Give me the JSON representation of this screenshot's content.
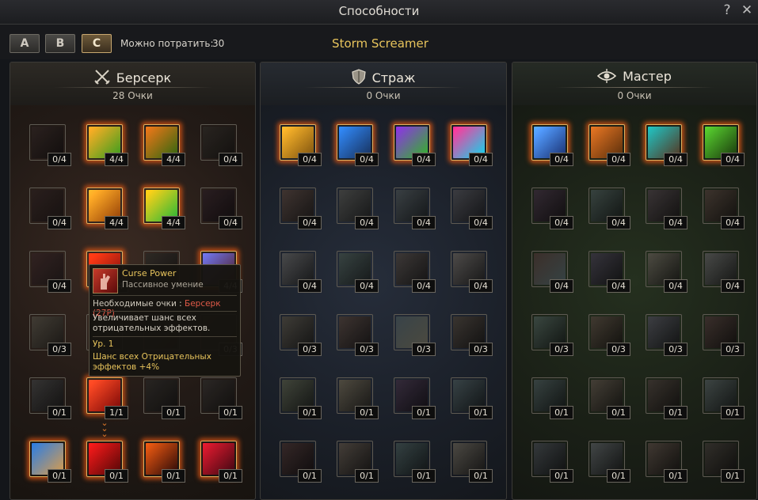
{
  "window": {
    "title": "Способности",
    "help_icon": "?",
    "close_icon": "✕"
  },
  "toolbar": {
    "tabs": [
      {
        "label": "A"
      },
      {
        "label": "B"
      },
      {
        "label": "C"
      }
    ],
    "active_tab": "C",
    "points_label": "Можно потратить:",
    "points_value": "30",
    "build_name": "Storm Screamer"
  },
  "panels": [
    {
      "key": "berserker",
      "name": "Берсерк",
      "points": "28 Очки",
      "icon": "crossed-swords-icon",
      "skills": [
        {
          "rank": "0/4",
          "active": false,
          "c1": "#8a3a2a",
          "c2": "#2a1410"
        },
        {
          "rank": "4/4",
          "active": true,
          "c1": "#e8a038",
          "c2": "#3a8a2a"
        },
        {
          "rank": "4/4",
          "active": true,
          "c1": "#d07028",
          "c2": "#2e5a18"
        },
        {
          "rank": "0/4",
          "active": false,
          "c1": "#6a4a2a",
          "c2": "#2a1e10"
        },
        {
          "rank": "0/4",
          "active": false,
          "c1": "#8a3028",
          "c2": "#3a1a14"
        },
        {
          "rank": "4/4",
          "active": true,
          "c1": "#f0b040",
          "c2": "#7a3a10"
        },
        {
          "rank": "4/4",
          "active": true,
          "c1": "#f0c030",
          "c2": "#30a040"
        },
        {
          "rank": "0/4",
          "active": false,
          "c1": "#8a2a4a",
          "c2": "#2a1020"
        },
        {
          "rank": "0/4",
          "active": false,
          "c1": "#b03030",
          "c2": "#402020"
        },
        {
          "rank": "4/4",
          "active": true,
          "c1": "#e04020",
          "c2": "#601010"
        },
        {
          "rank": "",
          "active": false,
          "c1": "#6a5030",
          "c2": "#2a2018"
        },
        {
          "rank": "4/4",
          "active": true,
          "c1": "#6a70d0",
          "c2": "#401818"
        },
        {
          "rank": "0/3",
          "active": false,
          "c1": "#a08040",
          "c2": "#3a2e18"
        },
        {
          "rank": "",
          "active": false,
          "c1": "#6a5030",
          "c2": "#2a2018"
        },
        {
          "rank": "",
          "active": false,
          "c1": "#6a5030",
          "c2": "#2a2018"
        },
        {
          "rank": "0/3",
          "active": false,
          "c1": "#8a6a3a",
          "c2": "#2a2016"
        },
        {
          "rank": "0/1",
          "active": false,
          "c1": "#707070",
          "c2": "#202020"
        },
        {
          "rank": "1/1",
          "active": true,
          "c1": "#e05030",
          "c2": "#600a0a"
        },
        {
          "rank": "0/1",
          "active": false,
          "c1": "#5a4a3a",
          "c2": "#241c14"
        },
        {
          "rank": "0/1",
          "active": false,
          "c1": "#6a5040",
          "c2": "#241a14"
        },
        {
          "rank": "0/1",
          "active": true,
          "c1": "#3070c0",
          "c2": "#c09050"
        },
        {
          "rank": "0/1",
          "active": true,
          "c1": "#d02020",
          "c2": "#400808"
        },
        {
          "rank": "0/1",
          "active": true,
          "c1": "#d05a20",
          "c2": "#200808"
        },
        {
          "rank": "0/1",
          "active": true,
          "c1": "#c02030",
          "c2": "#300810"
        }
      ]
    },
    {
      "key": "guardian",
      "name": "Страж",
      "points": "0 Очки",
      "icon": "shield-icon",
      "skills": [
        {
          "rank": "0/4",
          "active": true,
          "c1": "#e8b040",
          "c2": "#6a4a18"
        },
        {
          "rank": "0/4",
          "active": true,
          "c1": "#3a80d8",
          "c2": "#182a4a"
        },
        {
          "rank": "0/4",
          "active": true,
          "c1": "#7a30c0",
          "c2": "#3aa030"
        },
        {
          "rank": "0/4",
          "active": true,
          "c1": "#e03080",
          "c2": "#20c0d0"
        },
        {
          "rank": "0/4",
          "active": false,
          "c1": "#d06030",
          "c2": "#3a2010"
        },
        {
          "rank": "0/4",
          "active": false,
          "c1": "#8a8a70",
          "c2": "#2a2a24"
        },
        {
          "rank": "0/4",
          "active": false,
          "c1": "#6090a0",
          "c2": "#1a2a30"
        },
        {
          "rank": "0/4",
          "active": false,
          "c1": "#8080a0",
          "c2": "#24242e"
        },
        {
          "rank": "0/4",
          "active": false,
          "c1": "#a0a0a0",
          "c2": "#2a2a2a"
        },
        {
          "rank": "0/4",
          "active": false,
          "c1": "#40a080",
          "c2": "#183028"
        },
        {
          "rank": "0/4",
          "active": false,
          "c1": "#a07050",
          "c2": "#2e2016"
        },
        {
          "rank": "0/4",
          "active": false,
          "c1": "#c0a080",
          "c2": "#302a20"
        },
        {
          "rank": "0/3",
          "active": false,
          "c1": "#a08040",
          "c2": "#2a2414"
        },
        {
          "rank": "0/3",
          "active": false,
          "c1": "#c06030",
          "c2": "#301a10"
        },
        {
          "rank": "0/3",
          "active": false,
          "c1": "#40a0c0",
          "c2": "#c0a030"
        },
        {
          "rank": "0/3",
          "active": false,
          "c1": "#a06a30",
          "c2": "#2a1c10"
        },
        {
          "rank": "0/1",
          "active": false,
          "c1": "#80a030",
          "c2": "#202a10"
        },
        {
          "rank": "0/1",
          "active": false,
          "c1": "#d0a030",
          "c2": "#3a2a10"
        },
        {
          "rank": "0/1",
          "active": false,
          "c1": "#a040c0",
          "c2": "#2a1030"
        },
        {
          "rank": "0/1",
          "active": false,
          "c1": "#40a0b0",
          "c2": "#10282c"
        },
        {
          "rank": "0/1",
          "active": false,
          "c1": "#c04030",
          "c2": "#301010"
        },
        {
          "rank": "0/1",
          "active": false,
          "c1": "#c08040",
          "c2": "#302010"
        },
        {
          "rank": "0/1",
          "active": false,
          "c1": "#30a0a0",
          "c2": "#102a2a"
        },
        {
          "rank": "0/1",
          "active": false,
          "c1": "#c0a060",
          "c2": "#302818"
        }
      ]
    },
    {
      "key": "master",
      "name": "Мастер",
      "points": "0 Очки",
      "icon": "eye-icon",
      "skills": [
        {
          "rank": "0/4",
          "active": true,
          "c1": "#60a0f0",
          "c2": "#1a2a5a"
        },
        {
          "rank": "0/4",
          "active": true,
          "c1": "#c87030",
          "c2": "#4a2a10"
        },
        {
          "rank": "0/4",
          "active": true,
          "c1": "#30b0b0",
          "c2": "#4a3020"
        },
        {
          "rank": "0/4",
          "active": true,
          "c1": "#60c040",
          "c2": "#1a3010"
        },
        {
          "rank": "0/4",
          "active": false,
          "c1": "#a040a0",
          "c2": "#2a102a"
        },
        {
          "rank": "0/4",
          "active": false,
          "c1": "#40a090",
          "c2": "#102824"
        },
        {
          "rank": "0/4",
          "active": false,
          "c1": "#a06080",
          "c2": "#2a1820"
        },
        {
          "rank": "0/4",
          "active": false,
          "c1": "#c06030",
          "c2": "#301a10"
        },
        {
          "rank": "0/4",
          "active": false,
          "c1": "#d05030",
          "c2": "#30a0c0"
        },
        {
          "rank": "0/4",
          "active": false,
          "c1": "#8060c0",
          "c2": "#201830"
        },
        {
          "rank": "0/4",
          "active": false,
          "c1": "#c0a060",
          "c2": "#2a2418"
        },
        {
          "rank": "0/4",
          "active": false,
          "c1": "#a0a0a0",
          "c2": "#282828"
        },
        {
          "rank": "0/3",
          "active": false,
          "c1": "#40b080",
          "c2": "#102a20"
        },
        {
          "rank": "0/3",
          "active": false,
          "c1": "#c07030",
          "c2": "#2a1a0c"
        },
        {
          "rank": "0/3",
          "active": false,
          "c1": "#8080c0",
          "c2": "#202030"
        },
        {
          "rank": "0/3",
          "active": false,
          "c1": "#c05040",
          "c2": "#2a1410"
        },
        {
          "rank": "0/1",
          "active": false,
          "c1": "#40a0a0",
          "c2": "#102828"
        },
        {
          "rank": "0/1",
          "active": false,
          "c1": "#c08040",
          "c2": "#2a2010"
        },
        {
          "rank": "0/1",
          "active": false,
          "c1": "#a06040",
          "c2": "#281810"
        },
        {
          "rank": "0/1",
          "active": false,
          "c1": "#60a0a0",
          "c2": "#182828"
        },
        {
          "rank": "0/1",
          "active": false,
          "c1": "#6080a0",
          "c2": "#182028"
        },
        {
          "rank": "0/1",
          "active": false,
          "c1": "#80a0b0",
          "c2": "#1c2428"
        },
        {
          "rank": "0/1",
          "active": false,
          "c1": "#c07040",
          "c2": "#2a1a10"
        },
        {
          "rank": "0/1",
          "active": false,
          "c1": "#806040",
          "c2": "#201810"
        }
      ]
    }
  ],
  "tooltip": {
    "name": "Curse Power",
    "type": "Пассивное умение",
    "req_label": "Необходимые очки :",
    "req_value": "Берсерк (27P)",
    "description": "Увеличивает шанс всех отрицательных эффектов.",
    "level": "Ур. 1",
    "effect": "Шанс всех Отрицательных эффектов +4%"
  }
}
